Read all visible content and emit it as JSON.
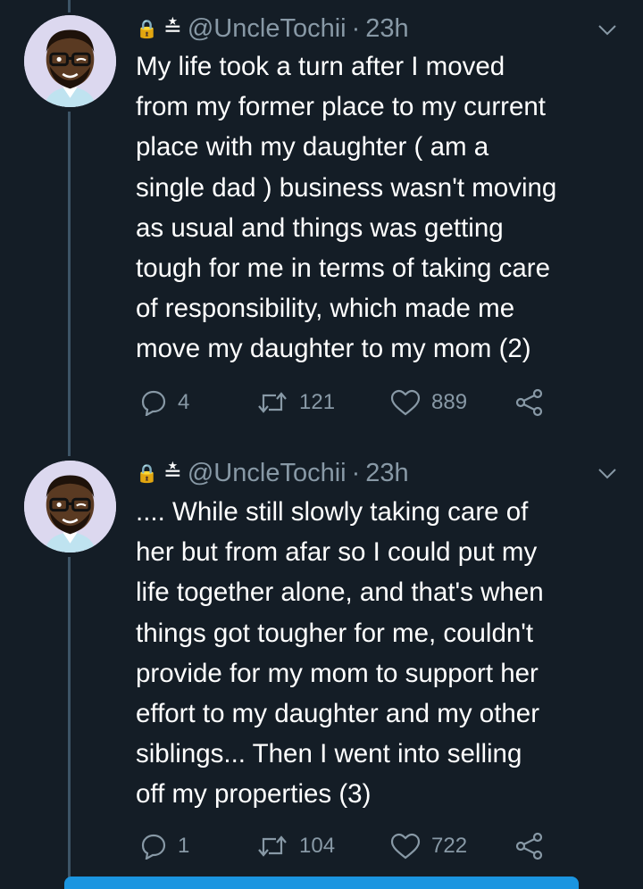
{
  "tweets": [
    {
      "handle": "@UncleTochii",
      "time": "23h",
      "lines": [
        "My life took a turn after I moved",
        "from my former place to my current",
        "place with my daughter ( am a",
        "single dad ) business wasn't moving",
        "as usual and things was getting",
        "tough for me in terms of taking care",
        "of responsibility, which made me",
        "move my daughter to my mom (2)"
      ],
      "replies": "4",
      "retweets": "121",
      "likes": "889"
    },
    {
      "handle": "@UncleTochii",
      "time": "23h",
      "lines": [
        ".... While still slowly taking care of",
        "her but from afar so I could put my",
        "life together alone, and that's when",
        "things got tougher for me,  couldn't",
        "provide for my mom to support her",
        "effort to my daughter and my other",
        "siblings... Then I went into selling",
        "off my properties (3)"
      ],
      "replies": "1",
      "retweets": "104",
      "likes": "722"
    }
  ],
  "icons": {
    "header_icons": "lock-icon, tweetdeck-icon",
    "menu": "chevron-down-icon"
  },
  "colors": {
    "background": "#141d26",
    "muted": "#8899a6",
    "accent": "#1b95e0"
  },
  "header_glyphs": {
    "lock": "🔒",
    "deck": "≛"
  },
  "separator": "·"
}
